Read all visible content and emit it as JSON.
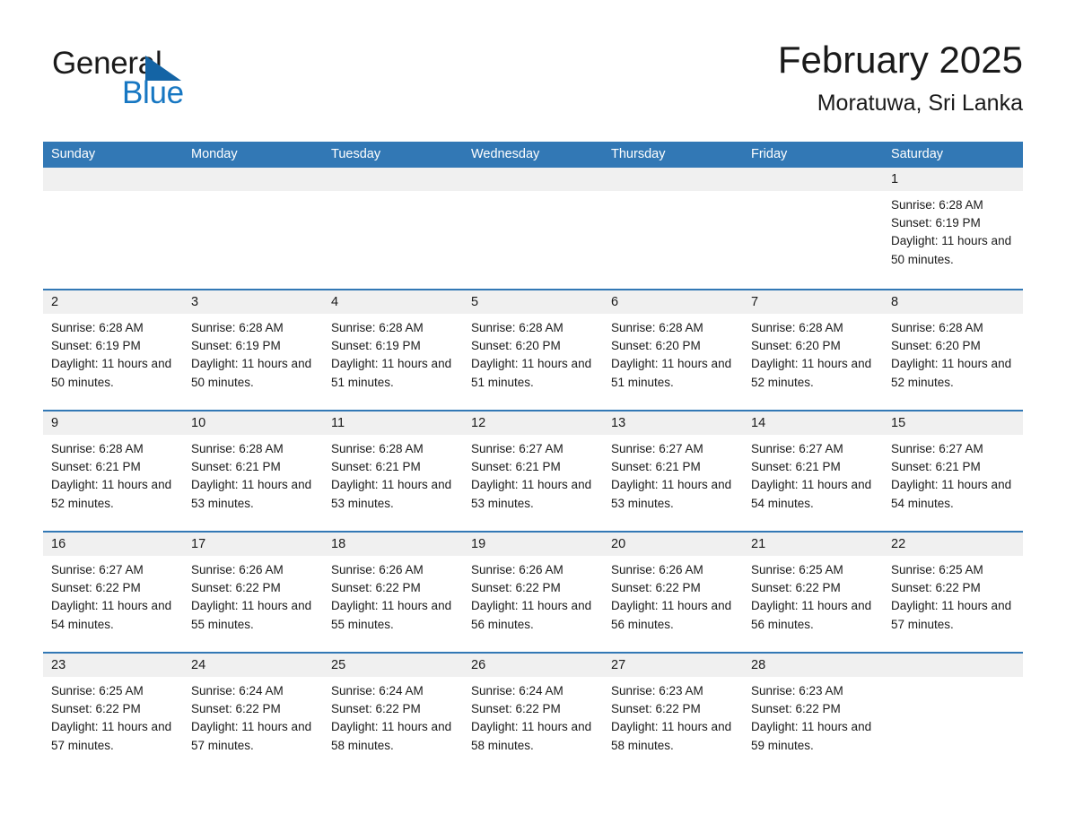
{
  "brand": {
    "name_part1": "General",
    "name_part2": "Blue",
    "triangle_color": "#1464a5",
    "blue_color": "#1777c2"
  },
  "header": {
    "title": "February 2025",
    "subtitle": "Moratuwa, Sri Lanka"
  },
  "theme": {
    "header_blue": "#3278b5",
    "day_band_gray": "#f0f0f0",
    "text_color": "#1a1a1a"
  },
  "weekdays": [
    "Sunday",
    "Monday",
    "Tuesday",
    "Wednesday",
    "Thursday",
    "Friday",
    "Saturday"
  ],
  "weeks": [
    [
      {
        "day": "",
        "sunrise": "",
        "sunset": "",
        "daylight": "",
        "empty": true
      },
      {
        "day": "",
        "sunrise": "",
        "sunset": "",
        "daylight": "",
        "empty": true
      },
      {
        "day": "",
        "sunrise": "",
        "sunset": "",
        "daylight": "",
        "empty": true
      },
      {
        "day": "",
        "sunrise": "",
        "sunset": "",
        "daylight": "",
        "empty": true
      },
      {
        "day": "",
        "sunrise": "",
        "sunset": "",
        "daylight": "",
        "empty": true
      },
      {
        "day": "",
        "sunrise": "",
        "sunset": "",
        "daylight": "",
        "empty": true
      },
      {
        "day": "1",
        "sunrise": "Sunrise: 6:28 AM",
        "sunset": "Sunset: 6:19 PM",
        "daylight": "Daylight: 11 hours and 50 minutes.",
        "empty": false
      }
    ],
    [
      {
        "day": "2",
        "sunrise": "Sunrise: 6:28 AM",
        "sunset": "Sunset: 6:19 PM",
        "daylight": "Daylight: 11 hours and 50 minutes.",
        "empty": false
      },
      {
        "day": "3",
        "sunrise": "Sunrise: 6:28 AM",
        "sunset": "Sunset: 6:19 PM",
        "daylight": "Daylight: 11 hours and 50 minutes.",
        "empty": false
      },
      {
        "day": "4",
        "sunrise": "Sunrise: 6:28 AM",
        "sunset": "Sunset: 6:19 PM",
        "daylight": "Daylight: 11 hours and 51 minutes.",
        "empty": false
      },
      {
        "day": "5",
        "sunrise": "Sunrise: 6:28 AM",
        "sunset": "Sunset: 6:20 PM",
        "daylight": "Daylight: 11 hours and 51 minutes.",
        "empty": false
      },
      {
        "day": "6",
        "sunrise": "Sunrise: 6:28 AM",
        "sunset": "Sunset: 6:20 PM",
        "daylight": "Daylight: 11 hours and 51 minutes.",
        "empty": false
      },
      {
        "day": "7",
        "sunrise": "Sunrise: 6:28 AM",
        "sunset": "Sunset: 6:20 PM",
        "daylight": "Daylight: 11 hours and 52 minutes.",
        "empty": false
      },
      {
        "day": "8",
        "sunrise": "Sunrise: 6:28 AM",
        "sunset": "Sunset: 6:20 PM",
        "daylight": "Daylight: 11 hours and 52 minutes.",
        "empty": false
      }
    ],
    [
      {
        "day": "9",
        "sunrise": "Sunrise: 6:28 AM",
        "sunset": "Sunset: 6:21 PM",
        "daylight": "Daylight: 11 hours and 52 minutes.",
        "empty": false
      },
      {
        "day": "10",
        "sunrise": "Sunrise: 6:28 AM",
        "sunset": "Sunset: 6:21 PM",
        "daylight": "Daylight: 11 hours and 53 minutes.",
        "empty": false
      },
      {
        "day": "11",
        "sunrise": "Sunrise: 6:28 AM",
        "sunset": "Sunset: 6:21 PM",
        "daylight": "Daylight: 11 hours and 53 minutes.",
        "empty": false
      },
      {
        "day": "12",
        "sunrise": "Sunrise: 6:27 AM",
        "sunset": "Sunset: 6:21 PM",
        "daylight": "Daylight: 11 hours and 53 minutes.",
        "empty": false
      },
      {
        "day": "13",
        "sunrise": "Sunrise: 6:27 AM",
        "sunset": "Sunset: 6:21 PM",
        "daylight": "Daylight: 11 hours and 53 minutes.",
        "empty": false
      },
      {
        "day": "14",
        "sunrise": "Sunrise: 6:27 AM",
        "sunset": "Sunset: 6:21 PM",
        "daylight": "Daylight: 11 hours and 54 minutes.",
        "empty": false
      },
      {
        "day": "15",
        "sunrise": "Sunrise: 6:27 AM",
        "sunset": "Sunset: 6:21 PM",
        "daylight": "Daylight: 11 hours and 54 minutes.",
        "empty": false
      }
    ],
    [
      {
        "day": "16",
        "sunrise": "Sunrise: 6:27 AM",
        "sunset": "Sunset: 6:22 PM",
        "daylight": "Daylight: 11 hours and 54 minutes.",
        "empty": false
      },
      {
        "day": "17",
        "sunrise": "Sunrise: 6:26 AM",
        "sunset": "Sunset: 6:22 PM",
        "daylight": "Daylight: 11 hours and 55 minutes.",
        "empty": false
      },
      {
        "day": "18",
        "sunrise": "Sunrise: 6:26 AM",
        "sunset": "Sunset: 6:22 PM",
        "daylight": "Daylight: 11 hours and 55 minutes.",
        "empty": false
      },
      {
        "day": "19",
        "sunrise": "Sunrise: 6:26 AM",
        "sunset": "Sunset: 6:22 PM",
        "daylight": "Daylight: 11 hours and 56 minutes.",
        "empty": false
      },
      {
        "day": "20",
        "sunrise": "Sunrise: 6:26 AM",
        "sunset": "Sunset: 6:22 PM",
        "daylight": "Daylight: 11 hours and 56 minutes.",
        "empty": false
      },
      {
        "day": "21",
        "sunrise": "Sunrise: 6:25 AM",
        "sunset": "Sunset: 6:22 PM",
        "daylight": "Daylight: 11 hours and 56 minutes.",
        "empty": false
      },
      {
        "day": "22",
        "sunrise": "Sunrise: 6:25 AM",
        "sunset": "Sunset: 6:22 PM",
        "daylight": "Daylight: 11 hours and 57 minutes.",
        "empty": false
      }
    ],
    [
      {
        "day": "23",
        "sunrise": "Sunrise: 6:25 AM",
        "sunset": "Sunset: 6:22 PM",
        "daylight": "Daylight: 11 hours and 57 minutes.",
        "empty": false
      },
      {
        "day": "24",
        "sunrise": "Sunrise: 6:24 AM",
        "sunset": "Sunset: 6:22 PM",
        "daylight": "Daylight: 11 hours and 57 minutes.",
        "empty": false
      },
      {
        "day": "25",
        "sunrise": "Sunrise: 6:24 AM",
        "sunset": "Sunset: 6:22 PM",
        "daylight": "Daylight: 11 hours and 58 minutes.",
        "empty": false
      },
      {
        "day": "26",
        "sunrise": "Sunrise: 6:24 AM",
        "sunset": "Sunset: 6:22 PM",
        "daylight": "Daylight: 11 hours and 58 minutes.",
        "empty": false
      },
      {
        "day": "27",
        "sunrise": "Sunrise: 6:23 AM",
        "sunset": "Sunset: 6:22 PM",
        "daylight": "Daylight: 11 hours and 58 minutes.",
        "empty": false
      },
      {
        "day": "28",
        "sunrise": "Sunrise: 6:23 AM",
        "sunset": "Sunset: 6:22 PM",
        "daylight": "Daylight: 11 hours and 59 minutes.",
        "empty": false
      },
      {
        "day": "",
        "sunrise": "",
        "sunset": "",
        "daylight": "",
        "empty": true
      }
    ]
  ]
}
